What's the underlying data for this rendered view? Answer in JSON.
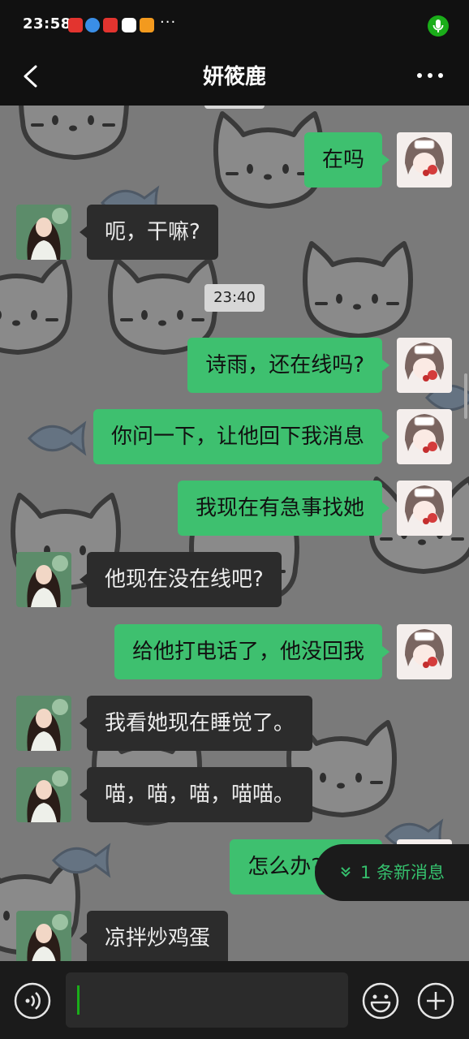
{
  "status_bar": {
    "time": "23:58",
    "overflow": "···",
    "notification_icons": [
      "app-icon-red",
      "app-icon-blue",
      "app-icon-red",
      "app-icon-chat",
      "app-icon-orange"
    ],
    "mic_color": "#1aad19"
  },
  "navbar": {
    "title": "妍筱鹿",
    "back_icon": "chevron-left-icon",
    "more_icon": "more-dots-icon"
  },
  "timestamp": "23:40",
  "messages": [
    {
      "from": "me",
      "text": "在吗"
    },
    {
      "from": "them",
      "text": "呃，干嘛?"
    },
    {
      "from": "me",
      "text": "诗雨，还在线吗?"
    },
    {
      "from": "me",
      "text": "你问一下，让他回下我消息"
    },
    {
      "from": "me",
      "text": "我现在有急事找她"
    },
    {
      "from": "them",
      "text": "他现在没在线吧?"
    },
    {
      "from": "me",
      "text": "给他打电话了，他没回我"
    },
    {
      "from": "them",
      "text": "我看她现在睡觉了。"
    },
    {
      "from": "them",
      "text": "喵，喵，喵，喵喵。"
    },
    {
      "from": "me",
      "text": "怎么办?我有"
    },
    {
      "from": "them",
      "text": "凉拌炒鸡蛋"
    }
  ],
  "new_message_banner": "1 条新消息",
  "input_bar": {
    "voice_icon": "voice-icon",
    "emoji_icon": "emoji-icon",
    "plus_icon": "plus-icon"
  },
  "colors": {
    "my_bubble": "#3ec06f",
    "their_bubble": "#2c2c2c",
    "accent": "#35c06d"
  }
}
